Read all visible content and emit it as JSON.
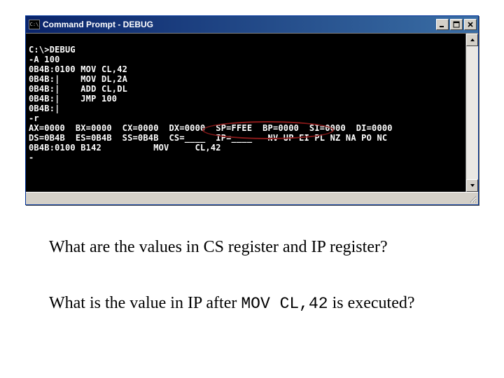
{
  "window": {
    "sys_icon_text": "C:\\",
    "title": "Command Prompt - DEBUG"
  },
  "console": {
    "l0": "C:\\>DEBUG",
    "l1": "-A 100",
    "l2": "0B4B:0100 MOV CL,42",
    "l3": "0B4B:|    MOV DL,2A",
    "l4": "0B4B:|    ADD CL,DL",
    "l5": "0B4B:|    JMP 100",
    "l6": "0B4B:|",
    "l7": "-r",
    "l8": "AX=0000  BX=0000  CX=0000  DX=0000  SP=FFEE  BP=0000  SI=0000  DI=0000",
    "l9": "DS=0B4B  ES=0B4B  SS=0B4B  CS=____  IP=____   NV UP EI PL NZ NA PO NC",
    "l10": "0B4B:0100 B142          MOV     CL,42",
    "l11": "-"
  },
  "questions": {
    "q1": "What are the values in CS register and IP register?",
    "q2_a": "What is the value in IP after ",
    "q2_code": "MOV CL,42",
    "q2_b": " is executed?"
  }
}
